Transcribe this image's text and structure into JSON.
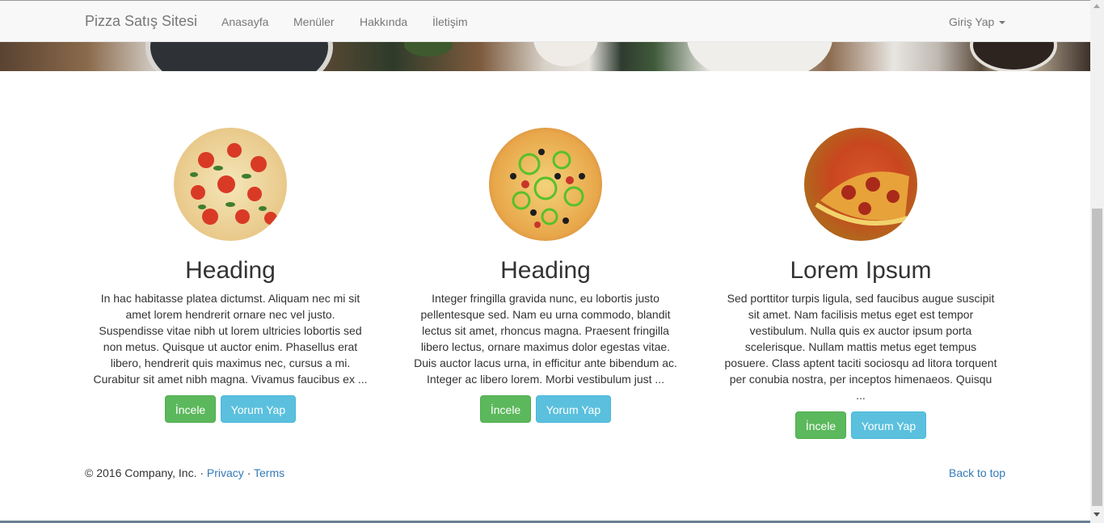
{
  "navbar": {
    "brand": "Pizza Satış Sitesi",
    "links": [
      "Anasayfa",
      "Menüler",
      "Hakkında",
      "İletişim"
    ],
    "login": "Giriş Yap"
  },
  "features": [
    {
      "image_icon": "margherita-pizza-image",
      "heading": "Heading",
      "text": "In hac habitasse platea dictumst. Aliquam nec mi sit amet lorem hendrerit ornare nec vel justo. Suspendisse vitae nibh ut lorem ultricies lobortis sed non metus. Quisque ut auctor enim. Phasellus erat libero, hendrerit quis maximus nec, cursus a mi. Curabitur sit amet nibh magna. Vivamus faucibus ex ...",
      "primary_button": "İncele",
      "secondary_button": "Yorum Yap"
    },
    {
      "image_icon": "vegetable-pizza-image",
      "heading": "Heading",
      "text": "Integer fringilla gravida nunc, eu lobortis justo pellentesque sed. Nam eu urna commodo, blandit lectus sit amet, rhoncus magna. Praesent fringilla libero lectus, ornare maximus dolor egestas vitae. Duis auctor lacus urna, in efficitur ante bibendum ac. Integer ac libero lorem. Morbi vestibulum just ...",
      "primary_button": "İncele",
      "secondary_button": "Yorum Yap"
    },
    {
      "image_icon": "pepperoni-pizza-image",
      "heading": "Lorem Ipsum",
      "text": "Sed porttitor turpis ligula, sed faucibus augue suscipit sit amet. Nam facilisis metus eget est tempor vestibulum. Nulla quis ex auctor ipsum porta scelerisque. Nullam mattis metus eget tempus posuere. Class aptent taciti sociosqu ad litora torquent per conubia nostra, per inceptos himenaeos. Quisqu ...",
      "primary_button": "İncele",
      "secondary_button": "Yorum Yap"
    }
  ],
  "footer": {
    "copyright": "© 2016 Company, Inc. ·",
    "privacy": "Privacy",
    "separator": "·",
    "terms": "Terms",
    "back_to_top": "Back to top"
  },
  "colors": {
    "success": "#5cb85c",
    "info": "#5bc0de",
    "link": "#337ab7"
  }
}
